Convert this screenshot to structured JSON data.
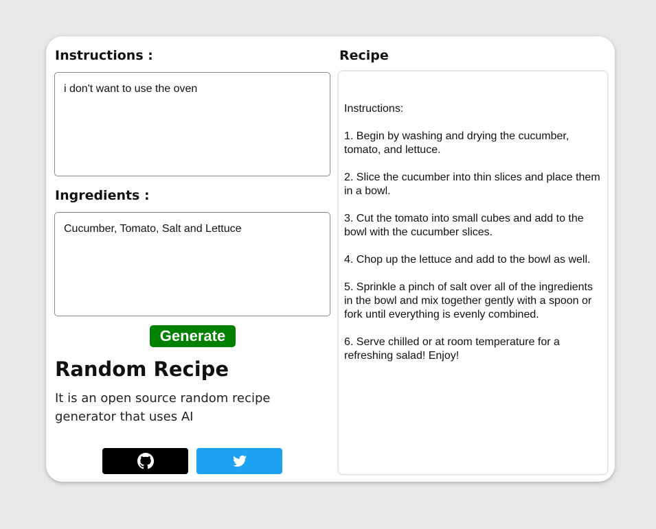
{
  "instructions": {
    "label": "Instructions :",
    "value": "i don't want to use the oven"
  },
  "ingredients": {
    "label": "Ingredients :",
    "value": "Cucumber, Tomato, Salt and Lettuce"
  },
  "generate_label": "Generate",
  "about": {
    "title": "Random Recipe",
    "description": "It is an open source random recipe generator that uses AI"
  },
  "social": {
    "github_icon": "github-icon",
    "twitter_icon": "twitter-icon"
  },
  "recipe": {
    "label": "Recipe",
    "text": "\nInstructions:\n\n1. Begin by washing and drying the cucumber, tomato, and lettuce.\n\n2. Slice the cucumber into thin slices and place them in a bowl.\n\n3. Cut the tomato into small cubes and add to the bowl with the cucumber slices.\n\n4. Chop up the lettuce and add to the bowl as well.\n\n5. Sprinkle a pinch of salt over all of the ingredients in the bowl and mix together gently with a spoon or fork until everything is evenly combined.\n\n6. Serve chilled or at room temperature for a refreshing salad! Enjoy!"
  },
  "colors": {
    "background": "#e8e8e8",
    "generate": "#008000",
    "github": "#000000",
    "twitter": "#1da1f2"
  }
}
